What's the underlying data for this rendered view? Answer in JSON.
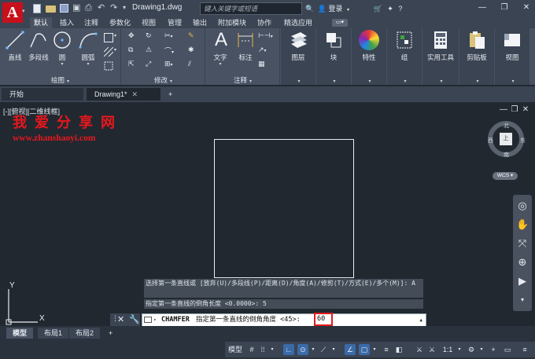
{
  "app": {
    "logo_letter": "A",
    "document_title": "Drawing1.dwg",
    "search_placeholder": "键入关键字或短语",
    "login": "登录"
  },
  "ribbon_tabs": [
    "默认",
    "插入",
    "注释",
    "参数化",
    "视图",
    "管理",
    "输出",
    "附加模块",
    "协作",
    "精选应用"
  ],
  "ribbon": {
    "draw_panel": {
      "title": "绘图",
      "line": "直线",
      "polyline": "多段线",
      "circle": "圆",
      "arc": "圆弧"
    },
    "modify_panel": {
      "title": "修改"
    },
    "annotation_panel": {
      "title": "注释",
      "text": "文字",
      "dimension": "标注"
    },
    "layer": "图层",
    "block": "块",
    "properties": "特性",
    "group": "组",
    "utilities": "实用工具",
    "clipboard": "剪贴板",
    "view": "视图"
  },
  "doc_tabs": {
    "start": "开始",
    "drawing": "Drawing1*",
    "add": "+"
  },
  "canvas": {
    "viewport_label": "[-][俯视][二维线框]",
    "watermark_title": "我爱分享网",
    "watermark_url": "www.zhanshaoyi.com",
    "viewcube": {
      "north": "北",
      "south": "南",
      "west": "西",
      "east": "东",
      "face": "上",
      "wcs": "WCS"
    },
    "ucs": {
      "y": "Y",
      "x": "X"
    }
  },
  "command": {
    "history_1": "选择第一条直线或 [放弃(U)/多段线(P)/距离(D)/角度(A)/修剪(T)/方式(E)/多个(M)]:  A",
    "history_2": "指定第一条直线的倒角长度 <0.0000>: 5",
    "name": "CHAMFER",
    "prompt": "指定第一条直线的倒角角度 <45>:",
    "value": "60"
  },
  "layout_tabs": [
    "模型",
    "布局1",
    "布局2"
  ],
  "status": {
    "model": "模型",
    "scale": "1:1"
  }
}
